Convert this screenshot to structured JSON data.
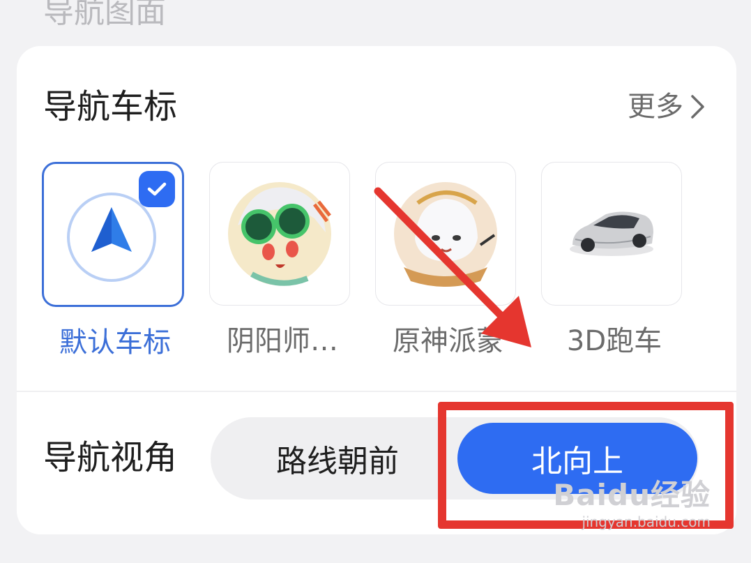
{
  "section_title": "导航图面",
  "vehicle_icons": {
    "title": "导航车标",
    "more_label": "更多",
    "items": [
      {
        "label": "默认车标",
        "selected": true
      },
      {
        "label": "阴阳师…",
        "selected": false
      },
      {
        "label": "原神派蒙",
        "selected": false
      },
      {
        "label": "3D跑车",
        "selected": false
      }
    ]
  },
  "view_angle": {
    "title": "导航视角",
    "options": [
      "路线朝前",
      "北向上"
    ],
    "selected": "北向上"
  },
  "watermark": {
    "logo": "Baidu经验",
    "url": "jingyan.baidu.com"
  },
  "colors": {
    "accent": "#2e6cf2",
    "selected_text": "#3c6fd8",
    "annotation_red": "#e5362f"
  },
  "icons": [
    "chevron-right-icon",
    "check-icon",
    "navigation-arrow-icon",
    "onmyoji-avatar-icon",
    "paimon-avatar-icon",
    "sports-car-icon"
  ]
}
